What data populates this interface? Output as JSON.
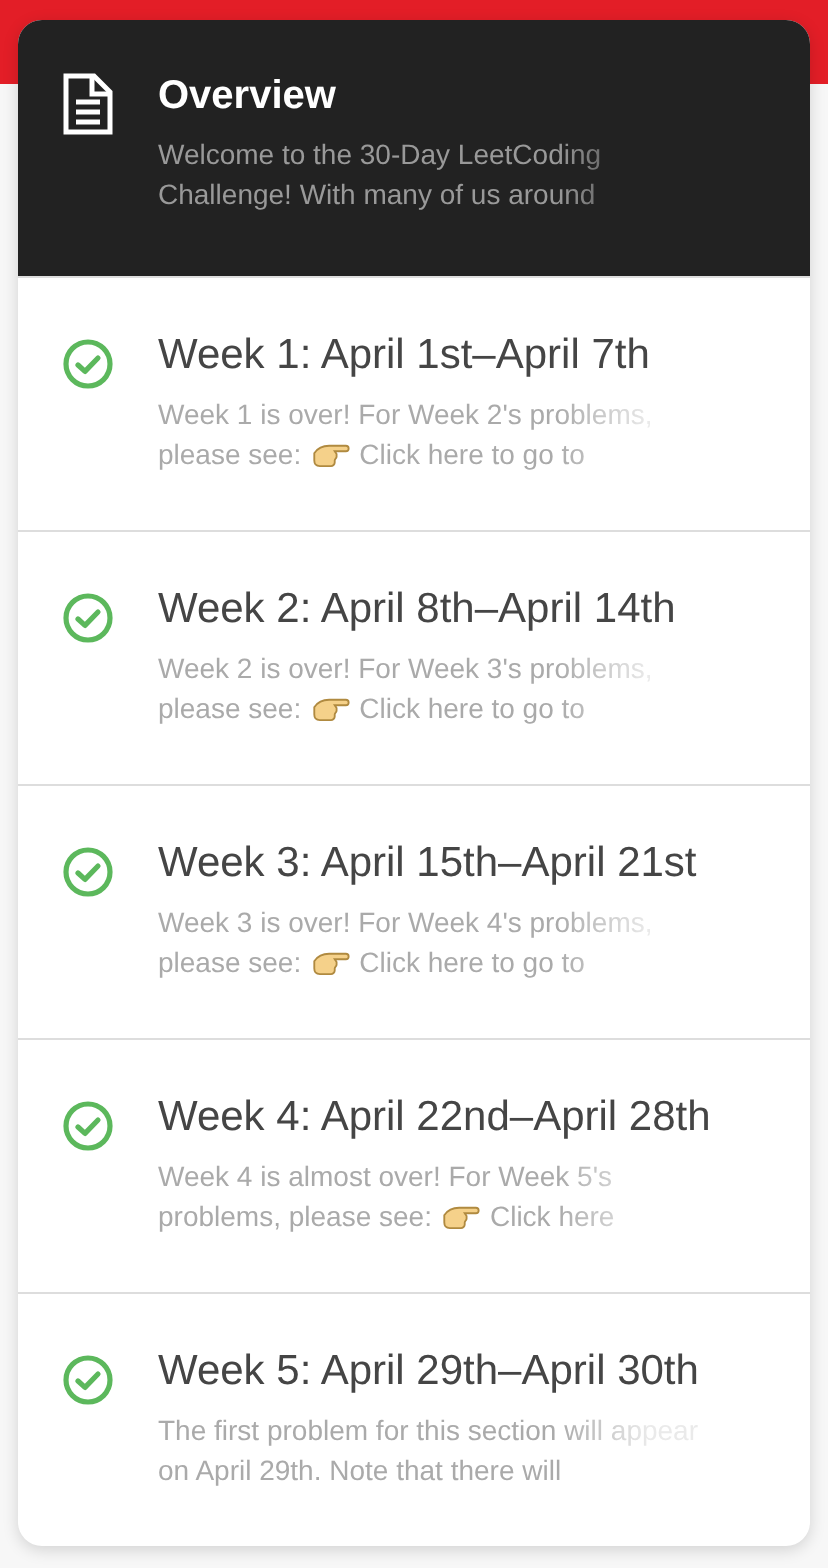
{
  "overview": {
    "title": "Overview",
    "summary_lines": [
      "Welcome to the 30-Day LeetCoding",
      "Challenge! With many of us around"
    ]
  },
  "weeks": [
    {
      "title": "Week 1: April 1st–April 7th",
      "summary_lines": [
        "Week 1 is over! For Week 2's problems,",
        "please see:"
      ],
      "link": "Click here to go to"
    },
    {
      "title": "Week 2: April 8th–April 14th",
      "summary_lines": [
        "Week 2 is over! For Week 3's problems,",
        "please see:"
      ],
      "link": "Click here to go to"
    },
    {
      "title": "Week 3: April 15th–April 21st",
      "summary_lines": [
        "Week 3 is over! For Week 4's problems,",
        "please see:"
      ],
      "link": "Click here to go to"
    },
    {
      "title": "Week 4: April 22nd–April 28th",
      "summary_lines": [
        "Week 4 is almost over! For Week 5's",
        "problems, please see:"
      ],
      "link": "Click here"
    },
    {
      "title": "Week 5: April 29th–April 30th",
      "summary_lines": [
        "The first problem for this section will appear",
        "on April 29th. Note that there will"
      ]
    }
  ]
}
